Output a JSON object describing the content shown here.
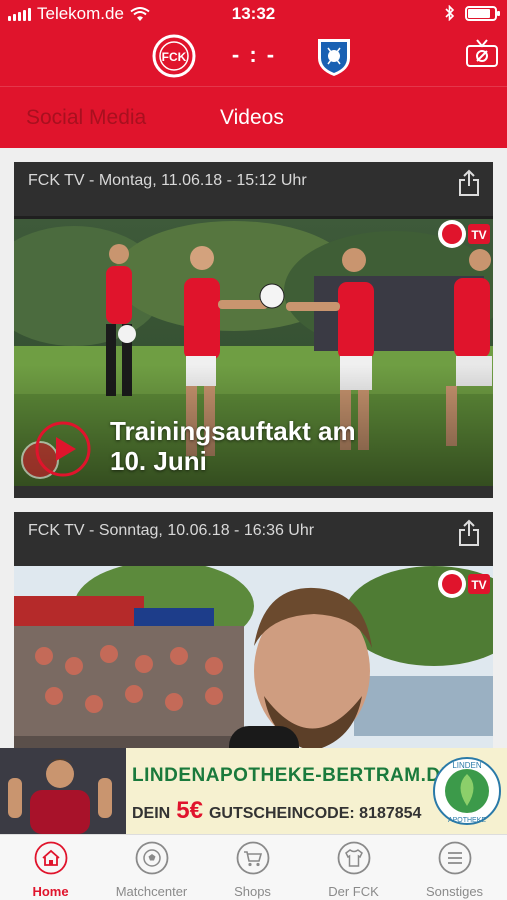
{
  "status_bar": {
    "carrier": "Telekom.de",
    "time": "13:32",
    "battery_level": 0.85
  },
  "match": {
    "score": "- : -",
    "home_logo_text": "FCK",
    "away_logo_name": "hoffenheim-crest-icon"
  },
  "tabs": [
    {
      "label": "Social Media",
      "active": false
    },
    {
      "label": "Videos",
      "active": true
    }
  ],
  "videos": [
    {
      "header": "FCK TV - Montag, 11.06.18 - 15:12 Uhr",
      "title_line1": "Trainingsauftakt am",
      "title_line2": "10. Juni",
      "watermark": "FCK"
    },
    {
      "header": "FCK TV - Sonntag, 10.06.18 - 16:36 Uhr",
      "watermark": "FCK"
    }
  ],
  "ad": {
    "line1": "LINDENAPOTHEKE-BERTRAM.DE",
    "line2_prefix": "DEIN",
    "line2_amount": "5€",
    "line2_code": "GUTSCHEINCODE: 8187854",
    "seal_top": "LINDEN",
    "seal_bottom": "APOTHEKE"
  },
  "nav": [
    {
      "label": "Home",
      "icon": "home-icon",
      "active": true
    },
    {
      "label": "Matchcenter",
      "icon": "football-icon",
      "active": false
    },
    {
      "label": "Shops",
      "icon": "cart-icon",
      "active": false
    },
    {
      "label": "Der FCK",
      "icon": "shirt-icon",
      "active": false
    },
    {
      "label": "Sonstiges",
      "icon": "menu-icon",
      "active": false
    }
  ],
  "colors": {
    "brand_red": "#e0142c",
    "card_dark": "#2f2f2f",
    "ad_green": "#1a7a3c"
  }
}
